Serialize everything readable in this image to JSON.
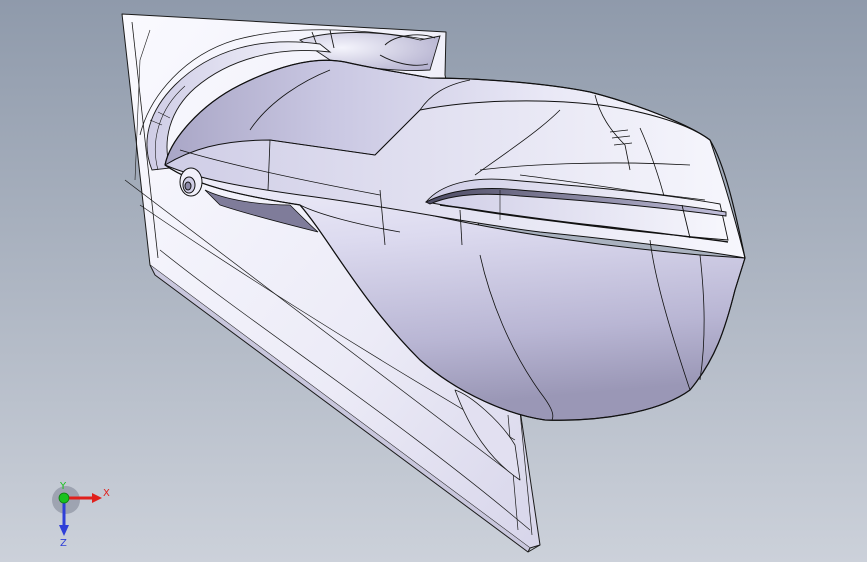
{
  "viewport": {
    "background_top": "#8f9aab",
    "background_bottom": "#c9ced8",
    "model": {
      "part": "side-mirror-housing",
      "fill_light": "#eceaf7",
      "fill_mid": "#c7c5e0",
      "fill_dark": "#8f8ca9",
      "edge_color": "#111111"
    },
    "triad": {
      "x_label": "X",
      "y_label": "Y",
      "z_label": "Z",
      "x_color": "#e0201c",
      "y_color": "#19c21e",
      "z_color": "#2f3fd8"
    }
  }
}
